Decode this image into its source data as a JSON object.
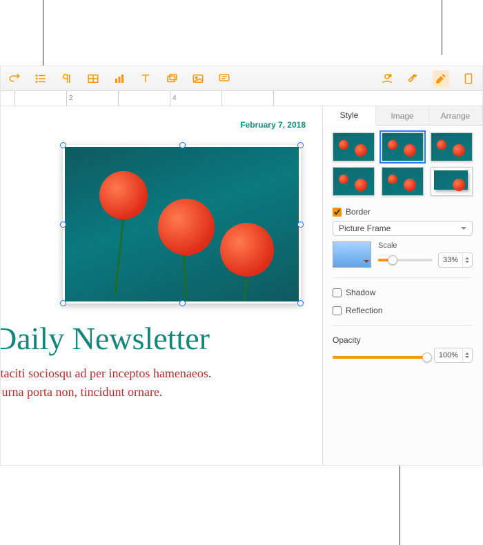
{
  "toolbar": {
    "icons": [
      "redo-icon",
      "list-icon",
      "paragraph-icon",
      "table-icon",
      "chart-icon",
      "text-icon",
      "shape-icon",
      "media-icon",
      "comment-icon",
      "collaborate-icon",
      "tools-icon",
      "format-icon",
      "document-icon"
    ]
  },
  "ruler": {
    "marks": [
      "",
      "2",
      "",
      "4",
      "",
      "",
      ""
    ]
  },
  "doc": {
    "date": "February 7, 2018",
    "title": "Daily Newsletter",
    "body_line1": "t taciti sociosqu ad per inceptos hamenaeos.",
    "body_line2": "s urna porta non, tincidunt ornare."
  },
  "inspector": {
    "tabs": {
      "style": "Style",
      "image": "Image",
      "arrange": "Arrange"
    },
    "border": {
      "label": "Border",
      "checked": true,
      "type": "Picture Frame",
      "scale_label": "Scale",
      "scale_value": "33%"
    },
    "shadow": {
      "label": "Shadow",
      "checked": false
    },
    "reflection": {
      "label": "Reflection",
      "checked": false
    },
    "opacity": {
      "label": "Opacity",
      "value": "100%"
    }
  }
}
